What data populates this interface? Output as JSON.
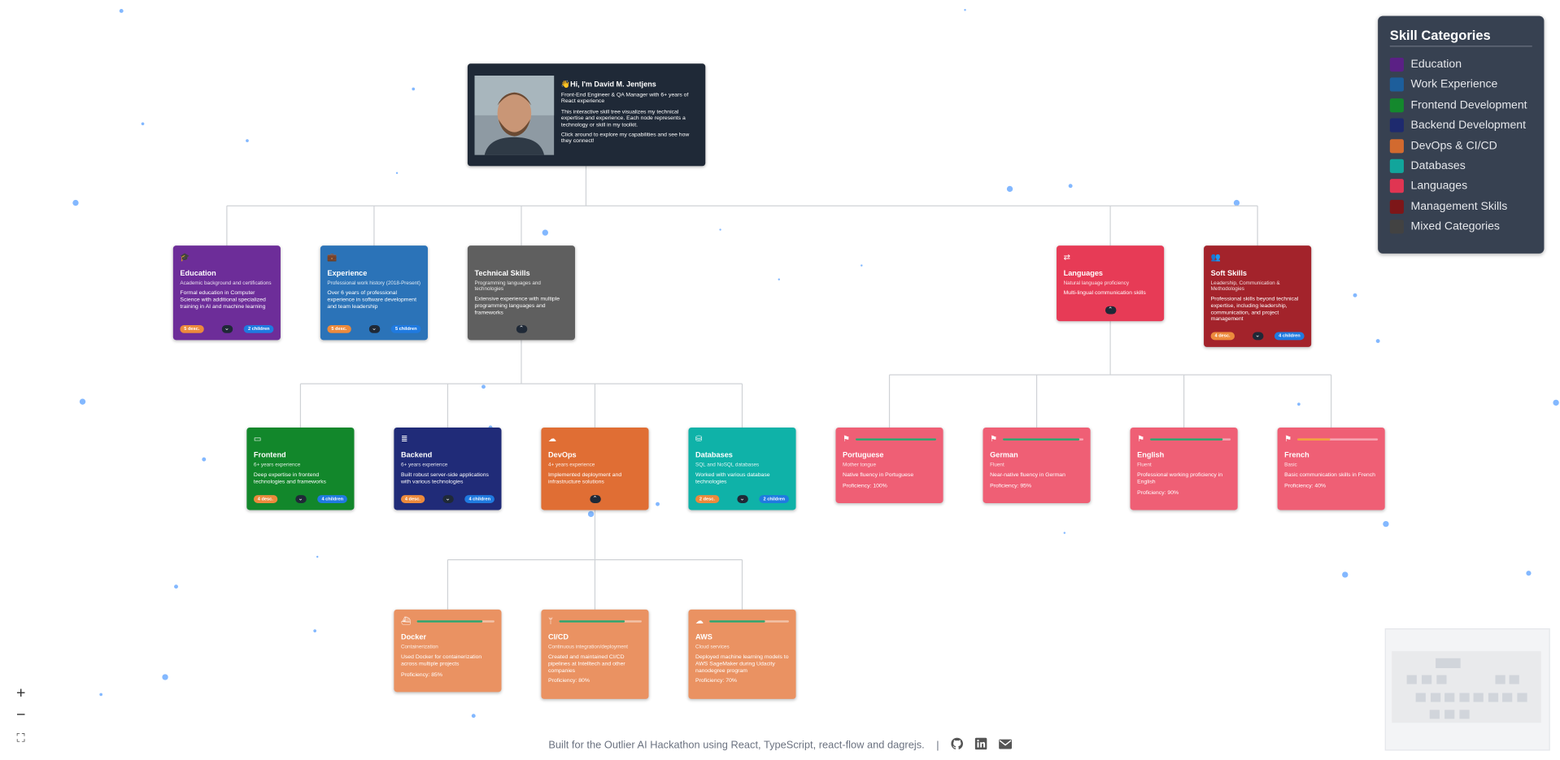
{
  "profile": {
    "greeting": "👋Hi, I'm David M. Jentjens",
    "lines": [
      "Front-End Engineer & QA Manager with 6+ years of React experience",
      "This interactive skill tree visualizes my technical expertise and experience. Each node represents a technology or skill in my toolkit.",
      "Click around to explore my capabilities and see how they connect!"
    ]
  },
  "nodes": {
    "education": {
      "icon": "graduation-cap-icon",
      "title": "Education",
      "subtitle": "Academic background and certifications",
      "desc": "Formal education in Computer Science with additional specialized training in AI and machine learning",
      "desc_badge": "5 desc.",
      "children_badge": "2 children",
      "color": "#6d2d99"
    },
    "experience": {
      "icon": "briefcase-icon",
      "title": "Experience",
      "subtitle": "Professional work history (2018-Present)",
      "desc": "Over 6 years of professional experience in software development and team leadership",
      "desc_badge": "5 desc.",
      "children_badge": "5 children",
      "color": "#2b73b8"
    },
    "technical": {
      "icon": "code-icon",
      "title": "Technical Skills",
      "subtitle": "Programming languages and technologies",
      "desc": "Extensive experience with multiple programming languages and frameworks",
      "color": "#5f5f5f"
    },
    "languages": {
      "icon": "language-icon",
      "title": "Languages",
      "subtitle": "Natural language proficiency",
      "desc": "Multi-lingual communication skills",
      "color": "#e73b56"
    },
    "soft": {
      "icon": "users-icon",
      "title": "Soft Skills",
      "subtitle": "Leadership, Communication & Methodologies",
      "desc": "Professional skills beyond technical expertise, including leadership, communication, and project management",
      "desc_badge": "4 desc.",
      "children_badge": "4 children",
      "color": "#a3232b"
    },
    "frontend": {
      "icon": "monitor-icon",
      "title": "Frontend",
      "subtitle": "6+ years experience",
      "desc": "Deep expertise in frontend technologies and frameworks",
      "desc_badge": "4 desc.",
      "children_badge": "4 children",
      "color": "#12872b"
    },
    "backend": {
      "icon": "server-icon",
      "title": "Backend",
      "subtitle": "6+ years experience",
      "desc": "Built robust server-side applications with various technologies",
      "desc_badge": "4 desc.",
      "children_badge": "4 children",
      "color": "#202b78"
    },
    "devops": {
      "icon": "cloud-upload-icon",
      "title": "DevOps",
      "subtitle": "4+ years experience",
      "desc": "Implemented deployment and infrastructure solutions",
      "color": "#e06e34"
    },
    "databases": {
      "icon": "database-icon",
      "title": "Databases",
      "subtitle": "SQL and NoSQL databases",
      "desc": "Worked with various database technologies",
      "desc_badge": "2 desc.",
      "children_badge": "2 children",
      "color": "#0fb2a8"
    },
    "portuguese": {
      "icon": "flag-icon",
      "title": "Portuguese",
      "subtitle": "Mother tongue",
      "desc": "Native fluency in Portuguese",
      "prof_label": "Proficiency: 100%",
      "prof": 100,
      "color": "#ef5f75"
    },
    "german": {
      "icon": "flag-icon",
      "title": "German",
      "subtitle": "Fluent",
      "desc": "Near-native fluency in German",
      "prof_label": "Proficiency: 95%",
      "prof": 95,
      "color": "#ef5f75"
    },
    "english": {
      "icon": "flag-icon",
      "title": "English",
      "subtitle": "Fluent",
      "desc": "Professional working proficiency in English",
      "prof_label": "Proficiency: 90%",
      "prof": 90,
      "color": "#ef5f75"
    },
    "french": {
      "icon": "flag-icon",
      "title": "French",
      "subtitle": "Basic",
      "desc": "Basic communication skills in French",
      "prof_label": "Proficiency: 40%",
      "prof": 40,
      "color": "#ef5f75"
    },
    "docker": {
      "icon": "docker-icon",
      "title": "Docker",
      "subtitle": "Containerization",
      "desc": "Used Docker for containerization across multiple projects",
      "prof_label": "Proficiency: 85%",
      "prof": 85,
      "color": "#ea9262"
    },
    "cicd": {
      "icon": "git-branch-icon",
      "title": "CI/CD",
      "subtitle": "Continuous integration/deployment",
      "desc": "Created and maintained CI/CD pipelines at Intelltech and other companies",
      "prof_label": "Proficiency: 80%",
      "prof": 80,
      "color": "#ea9262"
    },
    "aws": {
      "icon": "cloud-server-icon",
      "title": "AWS",
      "subtitle": "Cloud services",
      "desc": "Deployed machine learning models to AWS SageMaker during Udacity nanodegree program",
      "prof_label": "Proficiency: 70%",
      "prof": 70,
      "color": "#ea9262"
    }
  },
  "legend": {
    "title": "Skill Categories",
    "items": [
      {
        "label": "Education",
        "color": "#5b2085"
      },
      {
        "label": "Work Experience",
        "color": "#1d5e9b"
      },
      {
        "label": "Frontend Development",
        "color": "#14882d"
      },
      {
        "label": "Backend Development",
        "color": "#1e2a6e"
      },
      {
        "label": "DevOps & CI/CD",
        "color": "#d26a2f"
      },
      {
        "label": "Databases",
        "color": "#12a59b"
      },
      {
        "label": "Languages",
        "color": "#e03552"
      },
      {
        "label": "Management Skills",
        "color": "#7d1618"
      },
      {
        "label": "Mixed Categories",
        "color": "#424242"
      }
    ]
  },
  "controls": {
    "zoom_in": "+",
    "zoom_out": "−",
    "fit_view": "⛶"
  },
  "footer": {
    "text": "Built for the Outlier AI Hackathon using React, TypeScript, react-flow and dagrejs.",
    "separator": "|"
  }
}
